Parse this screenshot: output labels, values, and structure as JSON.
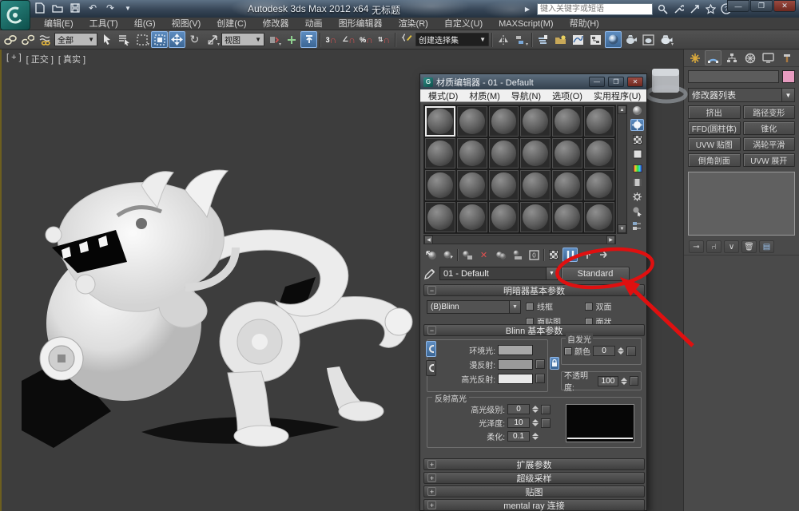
{
  "colors": {
    "accent_blue": "#4d7bab",
    "annotation_red": "#e01010",
    "object_color_swatch": "#e79cc0",
    "viewport_bg": "#3d3d3d"
  },
  "titlebar": {
    "app_title": "Autodesk 3ds Max 2012 x64",
    "doc_title": "无标题",
    "search_placeholder": "键入关键字或短语"
  },
  "menubar": {
    "items": [
      "编辑(E)",
      "工具(T)",
      "组(G)",
      "视图(V)",
      "创建(C)",
      "修改器",
      "动画",
      "图形编辑器",
      "渲染(R)",
      "自定义(U)",
      "MAXScript(M)",
      "帮助(H)"
    ]
  },
  "main_toolbar": {
    "selection_filter": "全部",
    "coord_system": "视图",
    "named_selection_set": "创建选择集",
    "snap_count": "3",
    "percent_glyph": "%"
  },
  "viewport": {
    "labels": [
      "[ + ]",
      "[ 正交 ]",
      "[ 真实 ]"
    ]
  },
  "command_panel": {
    "modifier_list_label": "修改器列表",
    "modifier_buttons": [
      "挤出",
      "路径变形",
      "FFD(圆柱体)",
      "锥化",
      "UVW 贴图",
      "涡轮平滑",
      "倒角剖面",
      "UVW 展开"
    ]
  },
  "material_editor": {
    "title": "材质编辑器 - 01 - Default",
    "menu_items": [
      "模式(D)",
      "材质(M)",
      "导航(N)",
      "选项(O)",
      "实用程序(U)"
    ],
    "sample_slots": {
      "rows": 4,
      "cols": 6,
      "selected_index": 0
    },
    "material_name": "01 - Default",
    "material_type": "Standard",
    "shader_rollout": {
      "title": "明暗器基本参数",
      "shader": "(B)Blinn",
      "checkboxes": [
        "线框",
        "双面",
        "面贴图",
        "面状"
      ]
    },
    "blinn_rollout": {
      "title": "Blinn 基本参数",
      "ambient_label": "环境光:",
      "diffuse_label": "漫反射:",
      "specular_label": "高光反射:",
      "self_illum_title": "自发光",
      "self_illum_color_label": "颜色",
      "self_illum_value": "0",
      "opacity_label": "不透明度:",
      "opacity_value": "100"
    },
    "specular_group": {
      "title": "反射高光",
      "level_label": "高光级别:",
      "level_value": "0",
      "gloss_label": "光泽度:",
      "gloss_value": "10",
      "soften_label": "柔化:",
      "soften_value": "0.1"
    },
    "collapsed_rollouts": [
      "扩展参数",
      "超级采样",
      "贴图",
      "mental ray 连接"
    ]
  }
}
